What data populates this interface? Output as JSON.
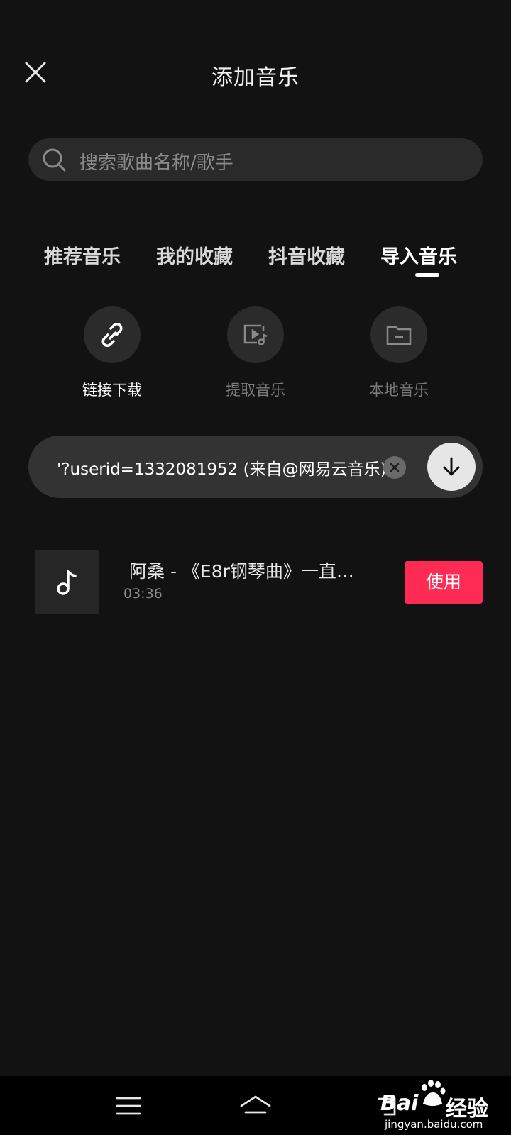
{
  "header": {
    "title": "添加音乐"
  },
  "search": {
    "placeholder": "搜索歌曲名称/歌手"
  },
  "tabs": [
    {
      "label": "推荐音乐",
      "active": false
    },
    {
      "label": "我的收藏",
      "active": false
    },
    {
      "label": "抖音收藏",
      "active": false
    },
    {
      "label": "导入音乐",
      "active": true
    }
  ],
  "sources": [
    {
      "label": "链接下载",
      "icon": "link-icon",
      "active": true
    },
    {
      "label": "提取音乐",
      "icon": "video-music-icon",
      "active": false
    },
    {
      "label": "本地音乐",
      "icon": "folder-icon",
      "active": false
    }
  ],
  "link_input": {
    "value": "'?userid=1332081952 (来自@网易云音乐)"
  },
  "song": {
    "title": "阿桑 - 《E8r钢琴曲》一直…",
    "duration": "03:36",
    "use_label": "使用"
  },
  "watermark": {
    "brand": "Bai",
    "brand2": "经验",
    "url": "jingyan.baidu.com"
  },
  "colors": {
    "accent": "#fe2c55",
    "background": "#121212"
  }
}
